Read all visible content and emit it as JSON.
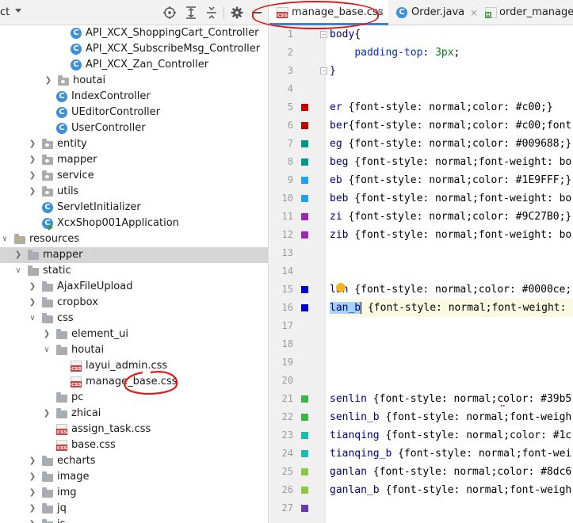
{
  "project_panel": {
    "title": "ct",
    "tree": [
      {
        "label": "API_XCX_ShoppingCart_Controller",
        "type": "class"
      },
      {
        "label": "API_XCX_SubscribeMsg_Controller",
        "type": "class"
      },
      {
        "label": "API_XCX_Zan_Controller",
        "type": "class"
      },
      {
        "label": "houtai",
        "type": "package"
      },
      {
        "label": "IndexController",
        "type": "class"
      },
      {
        "label": "UEditorController",
        "type": "class"
      },
      {
        "label": "UserController",
        "type": "class"
      },
      {
        "label": "entity",
        "type": "package"
      },
      {
        "label": "mapper",
        "type": "package"
      },
      {
        "label": "service",
        "type": "package"
      },
      {
        "label": "utils",
        "type": "package"
      },
      {
        "label": "ServletInitializer",
        "type": "class"
      },
      {
        "label": "XcxShop001Application",
        "type": "class"
      },
      {
        "label": "resources",
        "type": "resources"
      },
      {
        "label": "mapper",
        "type": "folder"
      },
      {
        "label": "static",
        "type": "folder"
      },
      {
        "label": "AjaxFileUpload",
        "type": "folder"
      },
      {
        "label": "cropbox",
        "type": "folder"
      },
      {
        "label": "css",
        "type": "folder"
      },
      {
        "label": "element_ui",
        "type": "folder"
      },
      {
        "label": "houtai",
        "type": "folder"
      },
      {
        "label": "layui_admin.css",
        "type": "css"
      },
      {
        "label": "manage_base.css",
        "type": "css"
      },
      {
        "label": "pc",
        "type": "folder"
      },
      {
        "label": "zhicai",
        "type": "folder"
      },
      {
        "label": "assign_task.css",
        "type": "css"
      },
      {
        "label": "base.css",
        "type": "css"
      },
      {
        "label": "echarts",
        "type": "folder"
      },
      {
        "label": "image",
        "type": "folder"
      },
      {
        "label": "img",
        "type": "folder"
      },
      {
        "label": "jq",
        "type": "folder"
      },
      {
        "label": "js",
        "type": "folder"
      }
    ]
  },
  "tabs": [
    {
      "label": "manage_base.css",
      "close": "×"
    },
    {
      "label": "Order.java",
      "close": "×"
    },
    {
      "label": "order_manage.h",
      "close": ""
    }
  ],
  "icon_badges": {
    "css": "css",
    "java": "C",
    "html": "H"
  },
  "editor": {
    "line_numbers": [
      "1",
      "2",
      "3",
      "4",
      "5",
      "6",
      "7",
      "8",
      "9",
      "10",
      "11",
      "12",
      "13",
      "14",
      "15",
      "16",
      "17",
      "18",
      "19",
      "20",
      "21",
      "22",
      "23",
      "24",
      "25",
      "26",
      "27"
    ],
    "fold_markers": {
      "open": "−",
      "close": "−"
    },
    "lines": [
      {
        "sel": "body",
        "rest": "{"
      },
      {
        "indent": "    ",
        "prop": "padding-top",
        "val": "3px",
        "end": ";"
      },
      {
        "sel": "}",
        "rest": ""
      },
      {
        "sel": "",
        "rest": ""
      },
      {
        "sel": "er",
        "rest": " {font-style: normal;color: #c00;}"
      },
      {
        "sel": "ber",
        "rest": "{font-style: normal;color: #c00;font"
      },
      {
        "sel": "eg",
        "rest": " {font-style: normal;color: #009688;}"
      },
      {
        "sel": "beg",
        "rest": " {font-style: normal;font-weight: bo"
      },
      {
        "sel": "eb",
        "rest": " {font-style: normal;color: #1E9FFF;}"
      },
      {
        "sel": "beb",
        "rest": " {font-style: normal;font-weight: bo"
      },
      {
        "sel": "zi",
        "rest": " {font-style: normal;color: #9C27B0;}"
      },
      {
        "sel": "zib",
        "rest": " {font-style: normal;font-weight: bo"
      },
      {
        "sel": "",
        "rest": ""
      },
      {
        "sel": "",
        "rest": ""
      },
      {
        "sel": "lan",
        "rest": " {font-style: normal;color: #0000ce;"
      },
      {
        "sel": "lan_b",
        "rest": " {font-style: normal;font-weight: "
      },
      {
        "sel": "",
        "rest": ""
      },
      {
        "sel": "",
        "rest": ""
      },
      {
        "sel": "",
        "rest": ""
      },
      {
        "sel": "",
        "rest": ""
      },
      {
        "sel": "senlin",
        "rest": " {font-style: normal;color: #39b5"
      },
      {
        "sel": "senlin_b",
        "rest": " {font-style: normal;font-weigh"
      },
      {
        "sel": "tianqing",
        "rest": " {font-style: normal;color: #1c"
      },
      {
        "sel": "tianqing_b",
        "rest": " {font-style: normal;font-wei"
      },
      {
        "sel": "ganlan",
        "rest": " {font-style: normal;color: #8dc6"
      },
      {
        "sel": "ganlan_b",
        "rest": " {font-style: normal;font-weigh"
      },
      {
        "sel": "",
        "rest": ""
      }
    ],
    "swatch_colors": {
      "5": "#c00000",
      "6": "#c00000",
      "7": "#009688",
      "8": "#009688",
      "9": "#1e9fff",
      "10": "#1e9fff",
      "11": "#9c27b0",
      "12": "#9c27b0",
      "15": "#0000ce",
      "16": "#0000ce",
      "21": "#39b54a",
      "22": "#39b54a",
      "23": "#1cbbb4",
      "24": "#1cbbb4",
      "25": "#8dc63f",
      "26": "#8dc63f",
      "27": "#6739b6"
    }
  },
  "colors": {
    "accent": "#4083c9",
    "annotation_red": "#e01818",
    "selection": "#d5d5d5"
  }
}
